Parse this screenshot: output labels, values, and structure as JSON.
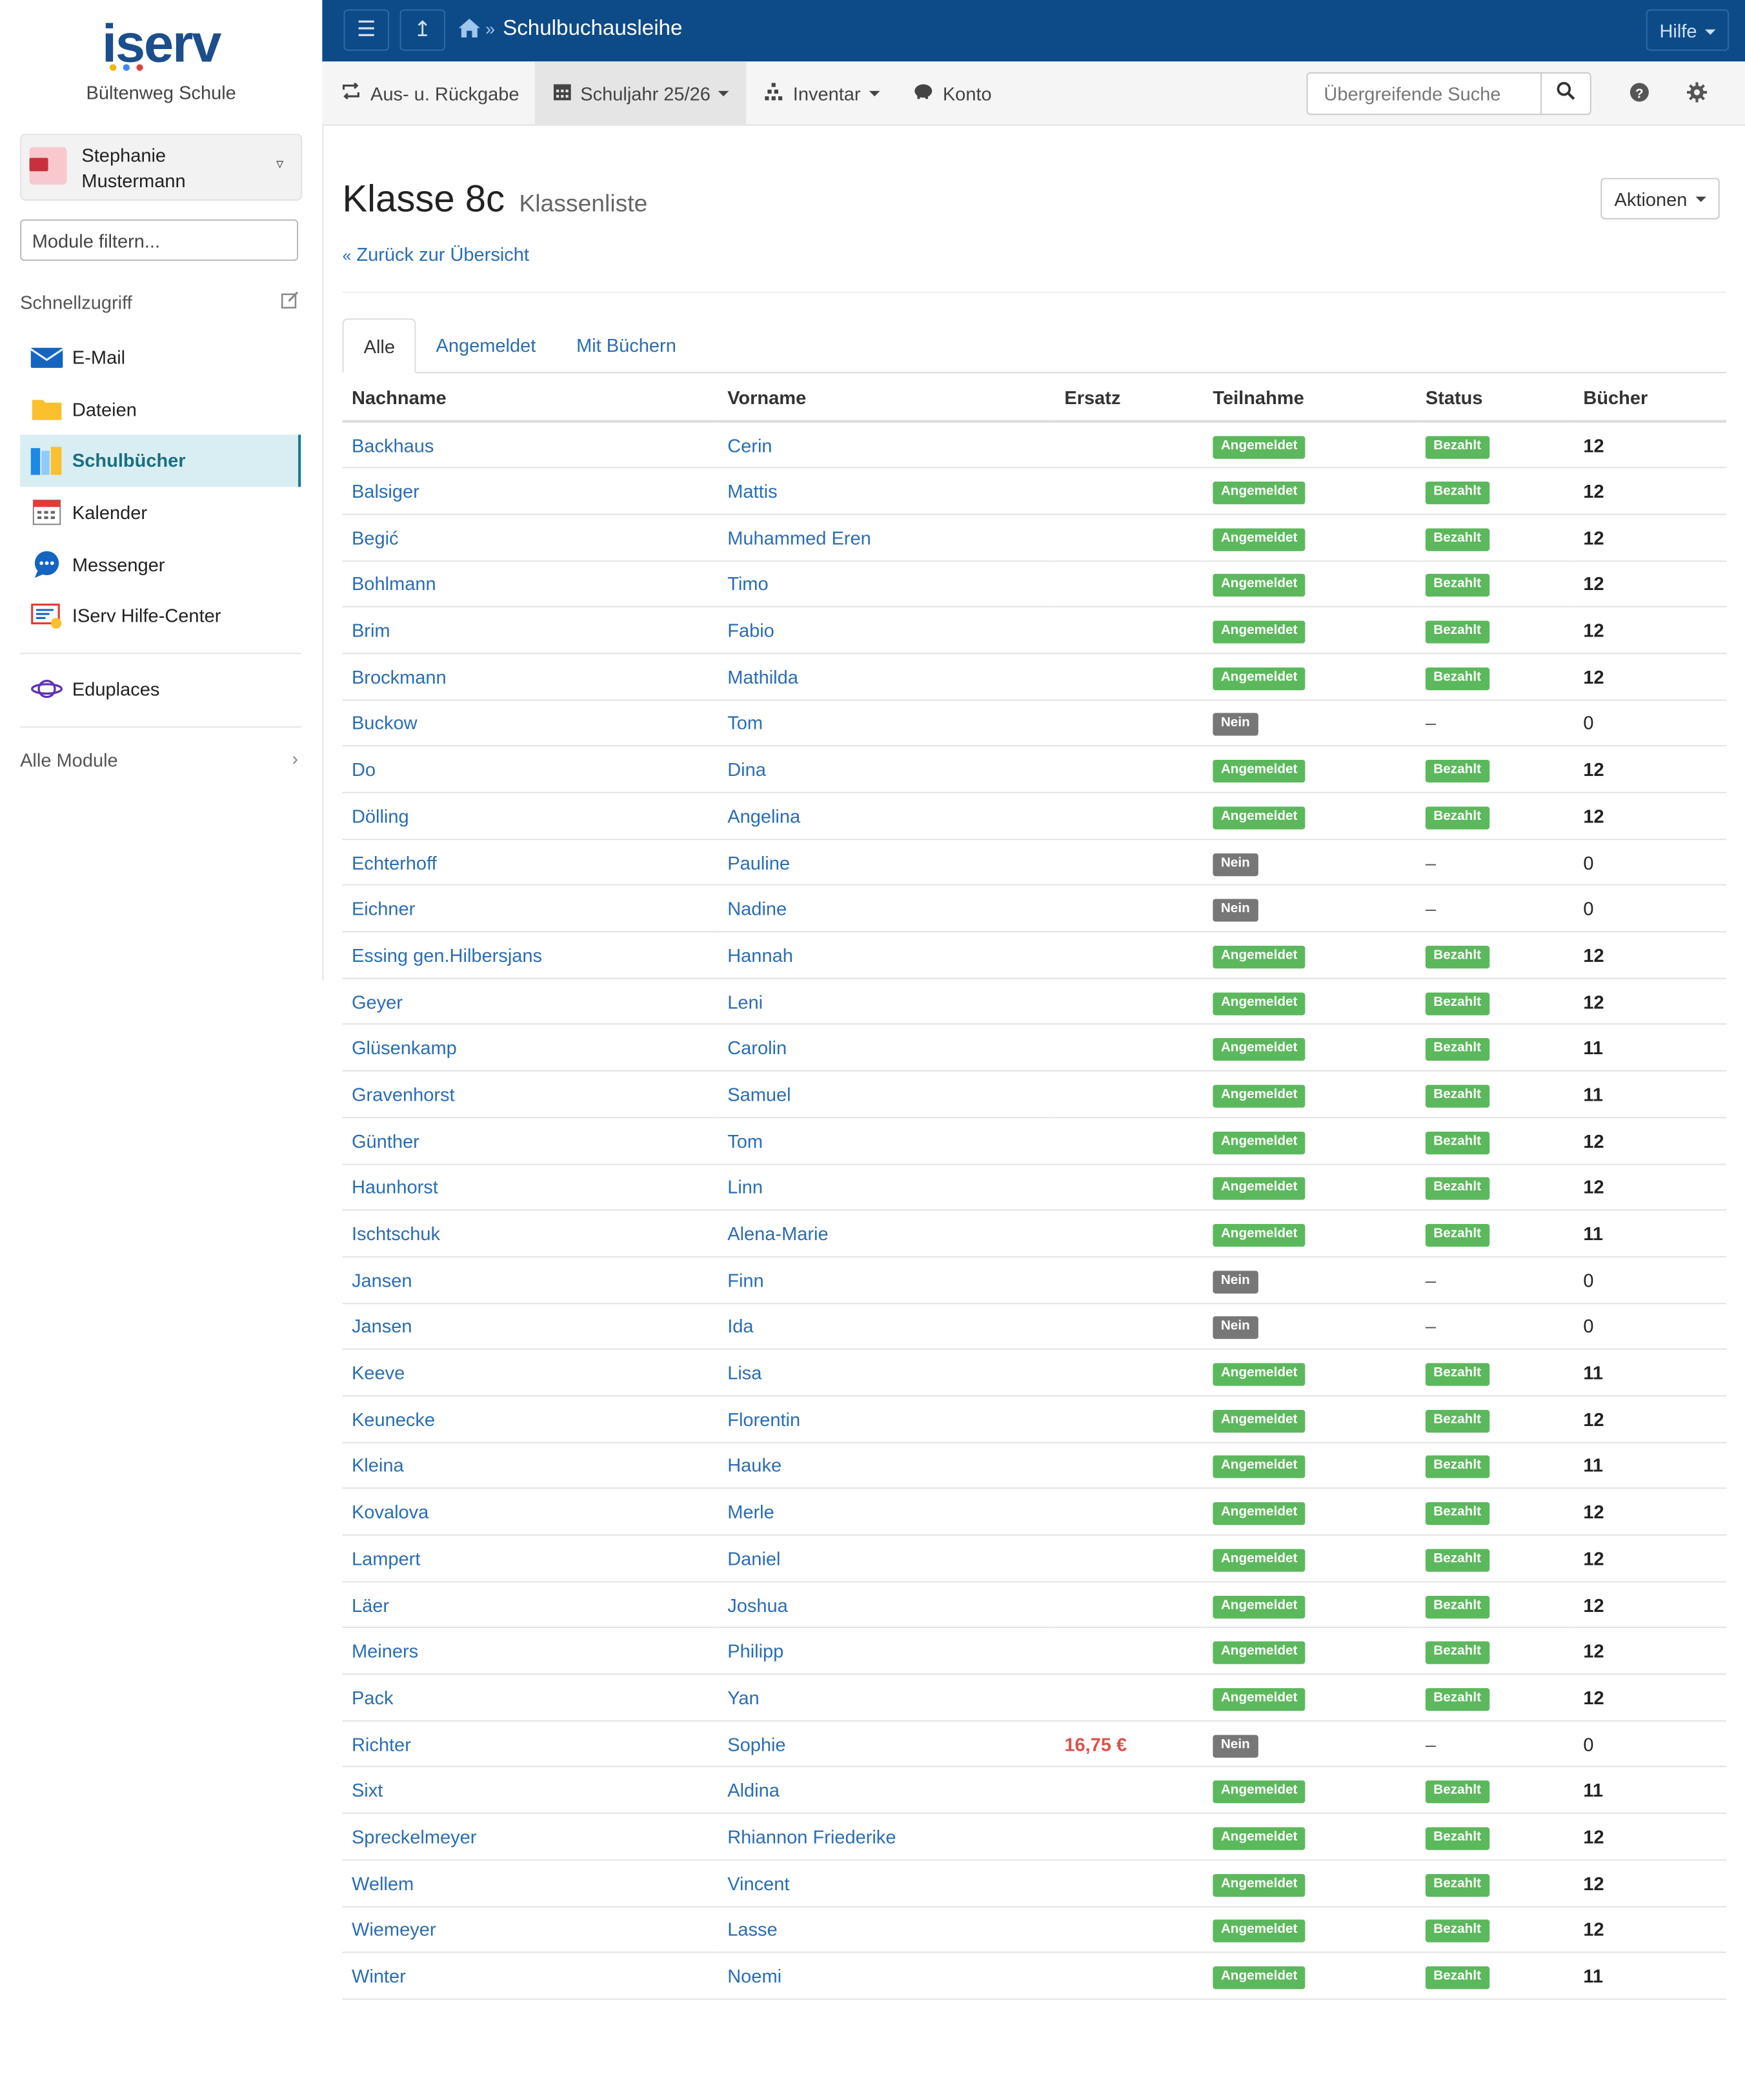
{
  "app": {
    "logo_text": "iserv",
    "school": "Bültenweg Schule",
    "header_title": "Schulbuchausleihe",
    "help_label": "Hilfe"
  },
  "user": {
    "first": "Stephanie",
    "last": "Mustermann"
  },
  "sidebar": {
    "filter_placeholder": "Module filtern...",
    "quick_access": "Schnellzugriff",
    "items": [
      {
        "label": "E-Mail",
        "icon": "mail-icon"
      },
      {
        "label": "Dateien",
        "icon": "folder-icon"
      },
      {
        "label": "Schulbücher",
        "icon": "books-icon"
      },
      {
        "label": "Kalender",
        "icon": "calendar-icon"
      },
      {
        "label": "Messenger",
        "icon": "chat-icon"
      },
      {
        "label": "IServ Hilfe-Center",
        "icon": "help-center-icon"
      }
    ],
    "extra": {
      "label": "Eduplaces",
      "icon": "eduplaces-icon"
    },
    "all_modules": "Alle Module"
  },
  "subnav": {
    "return": "Aus- u. Rückgabe",
    "year": "Schuljahr 25/26",
    "inventory": "Inventar",
    "account": "Konto",
    "search_placeholder": "Übergreifende Suche"
  },
  "page": {
    "title": "Klasse 8c",
    "subtitle": "Klassenliste",
    "actions": "Aktionen",
    "back": "Zurück zur Übersicht",
    "tabs": [
      "Alle",
      "Angemeldet",
      "Mit Büchern"
    ]
  },
  "table": {
    "headers": [
      "Nachname",
      "Vorname",
      "Ersatz",
      "Teilnahme",
      "Status",
      "Bücher"
    ],
    "rows": [
      [
        "Backhaus",
        "Cerin",
        "",
        "Angemeldet",
        "Bezahlt",
        "12"
      ],
      [
        "Balsiger",
        "Mattis",
        "",
        "Angemeldet",
        "Bezahlt",
        "12"
      ],
      [
        "Begić",
        "Muhammed Eren",
        "",
        "Angemeldet",
        "Bezahlt",
        "12"
      ],
      [
        "Bohlmann",
        "Timo",
        "",
        "Angemeldet",
        "Bezahlt",
        "12"
      ],
      [
        "Brim",
        "Fabio",
        "",
        "Angemeldet",
        "Bezahlt",
        "12"
      ],
      [
        "Brockmann",
        "Mathilda",
        "",
        "Angemeldet",
        "Bezahlt",
        "12"
      ],
      [
        "Buckow",
        "Tom",
        "",
        "Nein",
        "–",
        "0"
      ],
      [
        "Do",
        "Dina",
        "",
        "Angemeldet",
        "Bezahlt",
        "12"
      ],
      [
        "Dölling",
        "Angelina",
        "",
        "Angemeldet",
        "Bezahlt",
        "12"
      ],
      [
        "Echterhoff",
        "Pauline",
        "",
        "Nein",
        "–",
        "0"
      ],
      [
        "Eichner",
        "Nadine",
        "",
        "Nein",
        "–",
        "0"
      ],
      [
        "Essing gen.Hilbersjans",
        "Hannah",
        "",
        "Angemeldet",
        "Bezahlt",
        "12"
      ],
      [
        "Geyer",
        "Leni",
        "",
        "Angemeldet",
        "Bezahlt",
        "12"
      ],
      [
        "Glüsenkamp",
        "Carolin",
        "",
        "Angemeldet",
        "Bezahlt",
        "11"
      ],
      [
        "Gravenhorst",
        "Samuel",
        "",
        "Angemeldet",
        "Bezahlt",
        "11"
      ],
      [
        "Günther",
        "Tom",
        "",
        "Angemeldet",
        "Bezahlt",
        "12"
      ],
      [
        "Haunhorst",
        "Linn",
        "",
        "Angemeldet",
        "Bezahlt",
        "12"
      ],
      [
        "Ischtschuk",
        "Alena-Marie",
        "",
        "Angemeldet",
        "Bezahlt",
        "11"
      ],
      [
        "Jansen",
        "Finn",
        "",
        "Nein",
        "–",
        "0"
      ],
      [
        "Jansen",
        "Ida",
        "",
        "Nein",
        "–",
        "0"
      ],
      [
        "Keeve",
        "Lisa",
        "",
        "Angemeldet",
        "Bezahlt",
        "11"
      ],
      [
        "Keunecke",
        "Florentin",
        "",
        "Angemeldet",
        "Bezahlt",
        "12"
      ],
      [
        "Kleina",
        "Hauke",
        "",
        "Angemeldet",
        "Bezahlt",
        "11"
      ],
      [
        "Kovalova",
        "Merle",
        "",
        "Angemeldet",
        "Bezahlt",
        "12"
      ],
      [
        "Lampert",
        "Daniel",
        "",
        "Angemeldet",
        "Bezahlt",
        "12"
      ],
      [
        "Läer",
        "Joshua",
        "",
        "Angemeldet",
        "Bezahlt",
        "12"
      ],
      [
        "Meiners",
        "Philipp",
        "",
        "Angemeldet",
        "Bezahlt",
        "12"
      ],
      [
        "Pack",
        "Yan",
        "",
        "Angemeldet",
        "Bezahlt",
        "12"
      ],
      [
        "Richter",
        "Sophie",
        "16,75 €",
        "Nein",
        "–",
        "0"
      ],
      [
        "Sixt",
        "Aldina",
        "",
        "Angemeldet",
        "Bezahlt",
        "11"
      ],
      [
        "Spreckelmeyer",
        "Rhiannon Friederike",
        "",
        "Angemeldet",
        "Bezahlt",
        "12"
      ],
      [
        "Wellem",
        "Vincent",
        "",
        "Angemeldet",
        "Bezahlt",
        "12"
      ],
      [
        "Wiemeyer",
        "Lasse",
        "",
        "Angemeldet",
        "Bezahlt",
        "12"
      ],
      [
        "Winter",
        "Noemi",
        "",
        "Angemeldet",
        "Bezahlt",
        "11"
      ]
    ]
  },
  "colors": {
    "header": "#0d4a88",
    "link": "#2a6db3",
    "label_green": "#5cb85c",
    "label_gray": "#777777",
    "ersatz": "#d9534f"
  }
}
